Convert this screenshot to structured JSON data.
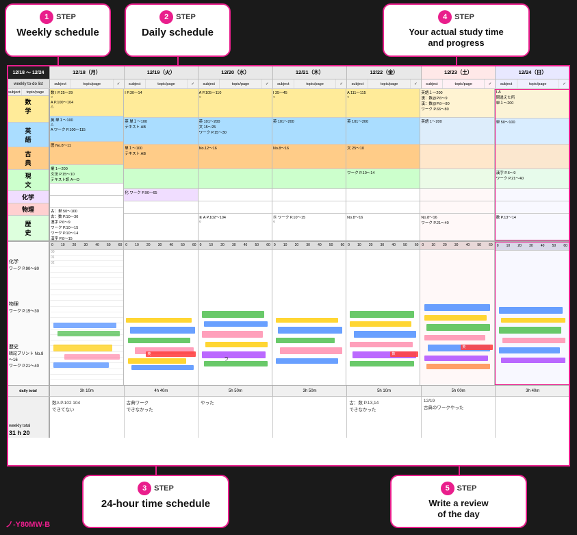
{
  "steps": {
    "step1": {
      "label": "STEP",
      "number": "1",
      "title": "Weekly schedule"
    },
    "step2": {
      "label": "STEP",
      "number": "2",
      "title": "Daily schedule"
    },
    "step3": {
      "label": "STEP",
      "number": "3",
      "title": "24-hour time schedule"
    },
    "step4": {
      "label": "STEP",
      "number": "4",
      "title": "Your actual study time\nand progress"
    },
    "step5": {
      "label": "STEP",
      "number": "5",
      "title": "Write a review\nof the day"
    }
  },
  "spreadsheet": {
    "week_range": "12/18 ～ 12/24",
    "days": [
      {
        "date": "12/18",
        "day": "月",
        "label": "12/18（月）"
      },
      {
        "date": "12/19",
        "day": "火",
        "label": "12/19（火）"
      },
      {
        "date": "12/20",
        "day": "水",
        "label": "12/20（水）"
      },
      {
        "date": "12/21",
        "day": "木",
        "label": "12/21（木）"
      },
      {
        "date": "12/22",
        "day": "金",
        "label": "12/22（金）"
      },
      {
        "date": "12/23",
        "day": "土",
        "label": "12/23（土）"
      },
      {
        "date": "12/24",
        "day": "日",
        "label": "12/24（日）"
      }
    ],
    "subjects": [
      {
        "name": "数学",
        "color": "#ffeb99"
      },
      {
        "name": "英語",
        "color": "#99ccff"
      },
      {
        "name": "古典",
        "color": "#ffcc99"
      },
      {
        "name": "現文",
        "color": "#e8f5e9"
      },
      {
        "name": "化学",
        "color": "#f8f0ff"
      },
      {
        "name": "物理",
        "color": "#fff0f0"
      },
      {
        "name": "歴史",
        "color": "#f0fff0"
      }
    ],
    "col_headers": [
      "subject",
      "topic/page",
      "✓"
    ],
    "daily_totals": [
      "3h 10m",
      "4h 40m",
      "5h 50m",
      "3h 50m",
      "5h 10m",
      "5h 00m",
      "3h 40m"
    ],
    "weekly_total": "31 h 20",
    "notes": [
      "数A P.102 104\nできてない",
      "古典ワーク\nできなかった",
      "やった",
      "",
      "古：数 P.13,14\nできなかった",
      "12/19\n古典のワークやった",
      ""
    ],
    "todo_list_header": "weekly to-do list",
    "daily_total_label": "daily total"
  },
  "watermark": "ノ-Y80MW-B"
}
